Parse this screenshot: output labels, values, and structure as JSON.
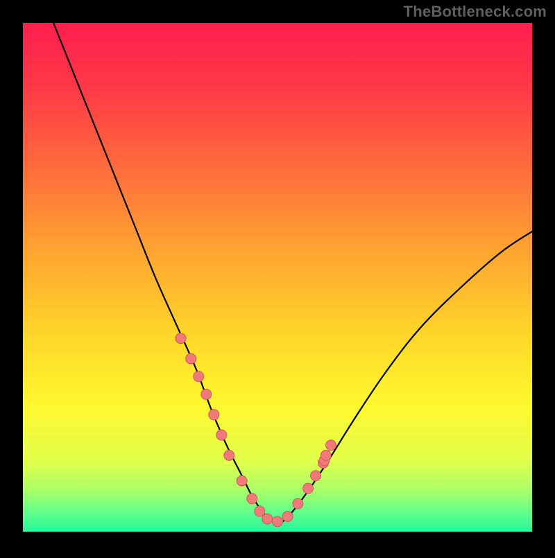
{
  "watermark": "TheBottleneck.com",
  "colors": {
    "frame": "#000000",
    "watermark": "#5f5f5f",
    "curve": "#000000",
    "markers_fill": "#f07a7a",
    "markers_stroke": "#ce5b5b",
    "gradient_stops": [
      {
        "offset": 0.0,
        "color": "#ff1f4e"
      },
      {
        "offset": 0.12,
        "color": "#ff3748"
      },
      {
        "offset": 0.28,
        "color": "#ff6a3c"
      },
      {
        "offset": 0.45,
        "color": "#ffa531"
      },
      {
        "offset": 0.62,
        "color": "#ffd829"
      },
      {
        "offset": 0.75,
        "color": "#fff82e"
      },
      {
        "offset": 0.86,
        "color": "#e2ff4a"
      },
      {
        "offset": 0.92,
        "color": "#a8ff6a"
      },
      {
        "offset": 0.965,
        "color": "#5cff8c"
      },
      {
        "offset": 1.0,
        "color": "#29f59b"
      }
    ]
  },
  "chart_data": {
    "type": "line",
    "title": "",
    "xlabel": "",
    "ylabel": "",
    "xlim": [
      0,
      100
    ],
    "ylim": [
      0,
      100
    ],
    "grid": false,
    "legend": false,
    "series": [
      {
        "name": "bottleneck-curve",
        "x": [
          6,
          10,
          14,
          18,
          22,
          26,
          30,
          34,
          37,
          40,
          43,
          45,
          47,
          49,
          51,
          53,
          56,
          60,
          65,
          71,
          78,
          86,
          94,
          100
        ],
        "y": [
          100,
          90,
          80,
          70,
          60,
          50,
          41,
          32,
          24,
          17,
          11,
          7,
          4,
          2,
          2,
          4,
          8,
          14,
          22,
          31,
          40,
          48,
          55,
          59
        ]
      }
    ],
    "markers": [
      {
        "x": 31.0,
        "y": 38.0
      },
      {
        "x": 33.0,
        "y": 34.0
      },
      {
        "x": 34.5,
        "y": 30.5
      },
      {
        "x": 36.0,
        "y": 27.0
      },
      {
        "x": 37.5,
        "y": 23.0
      },
      {
        "x": 39.0,
        "y": 19.0
      },
      {
        "x": 40.5,
        "y": 15.0
      },
      {
        "x": 43.0,
        "y": 10.0
      },
      {
        "x": 45.0,
        "y": 6.5
      },
      {
        "x": 46.5,
        "y": 4.0
      },
      {
        "x": 48.0,
        "y": 2.5
      },
      {
        "x": 50.0,
        "y": 2.0
      },
      {
        "x": 52.0,
        "y": 3.0
      },
      {
        "x": 54.0,
        "y": 5.5
      },
      {
        "x": 56.0,
        "y": 8.5
      },
      {
        "x": 57.5,
        "y": 11.0
      },
      {
        "x": 59.0,
        "y": 13.5
      },
      {
        "x": 59.2,
        "y": 14.0
      },
      {
        "x": 59.5,
        "y": 15.0
      },
      {
        "x": 60.5,
        "y": 17.0
      }
    ],
    "annotations": []
  }
}
